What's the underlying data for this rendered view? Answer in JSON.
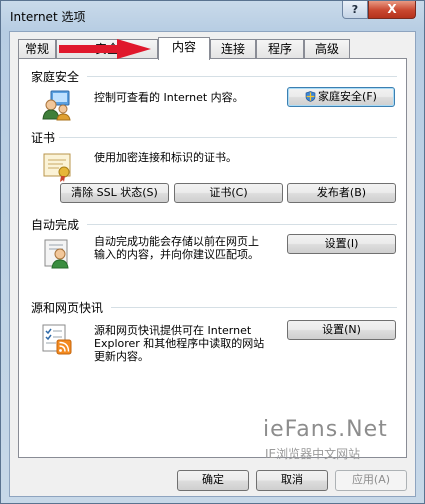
{
  "window": {
    "title": "Internet 选项",
    "help_label": "?",
    "close_label": "X"
  },
  "tabs": [
    {
      "label": "常规",
      "active": false
    },
    {
      "label": "安全",
      "active": false
    },
    {
      "label": "内容",
      "active": true
    },
    {
      "label": "连接",
      "active": false
    },
    {
      "label": "程序",
      "active": false
    },
    {
      "label": "高级",
      "active": false
    }
  ],
  "family_safety": {
    "heading": "家庭安全",
    "description": "控制可查看的 Internet 内容。",
    "button_label": "家庭安全(F)",
    "icon": "family-users-icon"
  },
  "certificates": {
    "heading": "证书",
    "description": "使用加密连接和标识的证书。",
    "clear_ssl_label": "清除 SSL 状态(S)",
    "certificates_label": "证书(C)",
    "publishers_label": "发布者(B)",
    "icon": "certificate-icon"
  },
  "autocomplete": {
    "heading": "自动完成",
    "description_line1": "自动完成功能会存储以前在网页上",
    "description_line2": "输入的内容，并向你建议匹配项。",
    "button_label": "设置(I)",
    "icon": "autocomplete-user-icon"
  },
  "feeds": {
    "heading": "源和网页快讯",
    "description_line1": "源和网页快讯提供可在 Internet",
    "description_line2": "Explorer 和其他程序中读取的网站",
    "description_line3": "更新内容。",
    "button_label": "设置(N)",
    "icon": "feeds-icon"
  },
  "footer": {
    "ok_label": "确定",
    "cancel_label": "取消",
    "apply_label": "应用(A)"
  },
  "watermark": {
    "line1": "ieFans.Net",
    "line2": "IE浏览器中文网站"
  },
  "colors": {
    "arrow": "#e0182c",
    "focus_border": "#3c7fb1",
    "rule": "#d5dfe5"
  }
}
